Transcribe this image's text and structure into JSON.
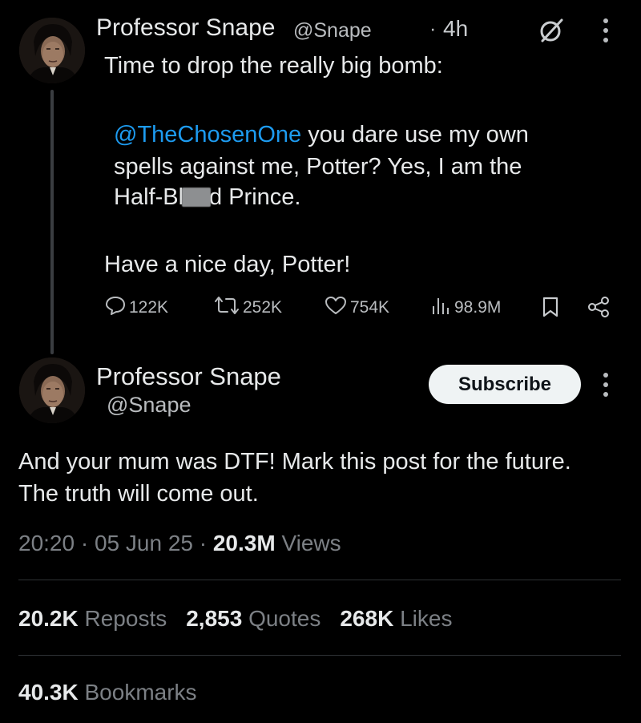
{
  "reply_tweet": {
    "author_name": "Professor Snape",
    "author_handle": "@Snape",
    "separator": "·",
    "time_ago": "4h",
    "line1": "Time to drop the really big bomb:",
    "mention": "@TheChosenOne",
    "line2_rest": " you dare use my own",
    "line3": "spells against me, Potter? Yes, I am the",
    "line4_pre": "Half-Bl",
    "line4_post": "d Prince.",
    "line5": "Have a nice day, Potter!",
    "metrics": {
      "replies": "122K",
      "reposts": "252K",
      "likes": "754K",
      "views": "98.9M"
    },
    "icons": [
      "reply-icon",
      "retweet-icon",
      "heart-icon",
      "views-icon",
      "bookmark-icon",
      "share-icon",
      "grok-icon",
      "more-icon"
    ]
  },
  "main_tweet": {
    "author_name": "Professor Snape",
    "author_handle": "@Snape",
    "subscribe_label": "Subscribe",
    "body_line1": "And your mum was DTF! Mark this post for the future.",
    "body_line2": "The truth will come out.",
    "time": "20:20",
    "date": "05 Jun 25",
    "dot": "·",
    "views_count": "20.3M",
    "views_label": "Views",
    "reposts_count": "20.2K",
    "reposts_label": "Reposts",
    "quotes_count": "2,853",
    "quotes_label": "Quotes",
    "likes_count": "268K",
    "likes_label": "Likes",
    "bookmarks_count": "40.3K",
    "bookmarks_label": "Bookmarks"
  },
  "colors": {
    "background": "#000000",
    "text_primary": "#e7e9ea",
    "text_secondary": "#7c8085",
    "mention": "#1d9bf0",
    "divider": "#2f3336",
    "button_bg": "#eff3f4"
  }
}
